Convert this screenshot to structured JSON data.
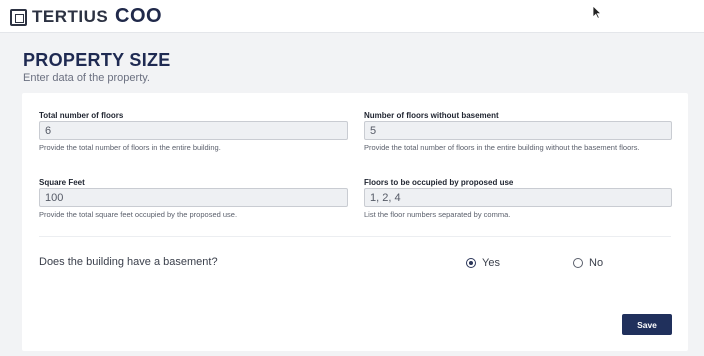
{
  "header": {
    "brand": "TERTIUS",
    "app_name": "COO"
  },
  "page": {
    "title": "PROPERTY SIZE",
    "subtitle": "Enter data of the property."
  },
  "form": {
    "total_floors": {
      "label": "Total number of floors",
      "value": "6",
      "help": "Provide the total number of floors in the entire building."
    },
    "floors_without_basement": {
      "label": "Number of floors without basement",
      "value": "5",
      "help": "Provide the total number of floors in the entire building without the basement floors."
    },
    "square_feet": {
      "label": "Square Feet",
      "value": "100",
      "help": "Provide the total square feet occupied by the proposed use."
    },
    "floors_occupied": {
      "label": "Floors to be occupied by proposed use",
      "value": "1, 2, 4",
      "help": "List the floor numbers separated by comma."
    },
    "basement_question": {
      "label": "Does the building have a basement?",
      "options": [
        "Yes",
        "No"
      ],
      "selected": "Yes"
    },
    "save_label": "Save"
  },
  "colors": {
    "primary": "#20305c",
    "heading": "#1f2a52"
  }
}
